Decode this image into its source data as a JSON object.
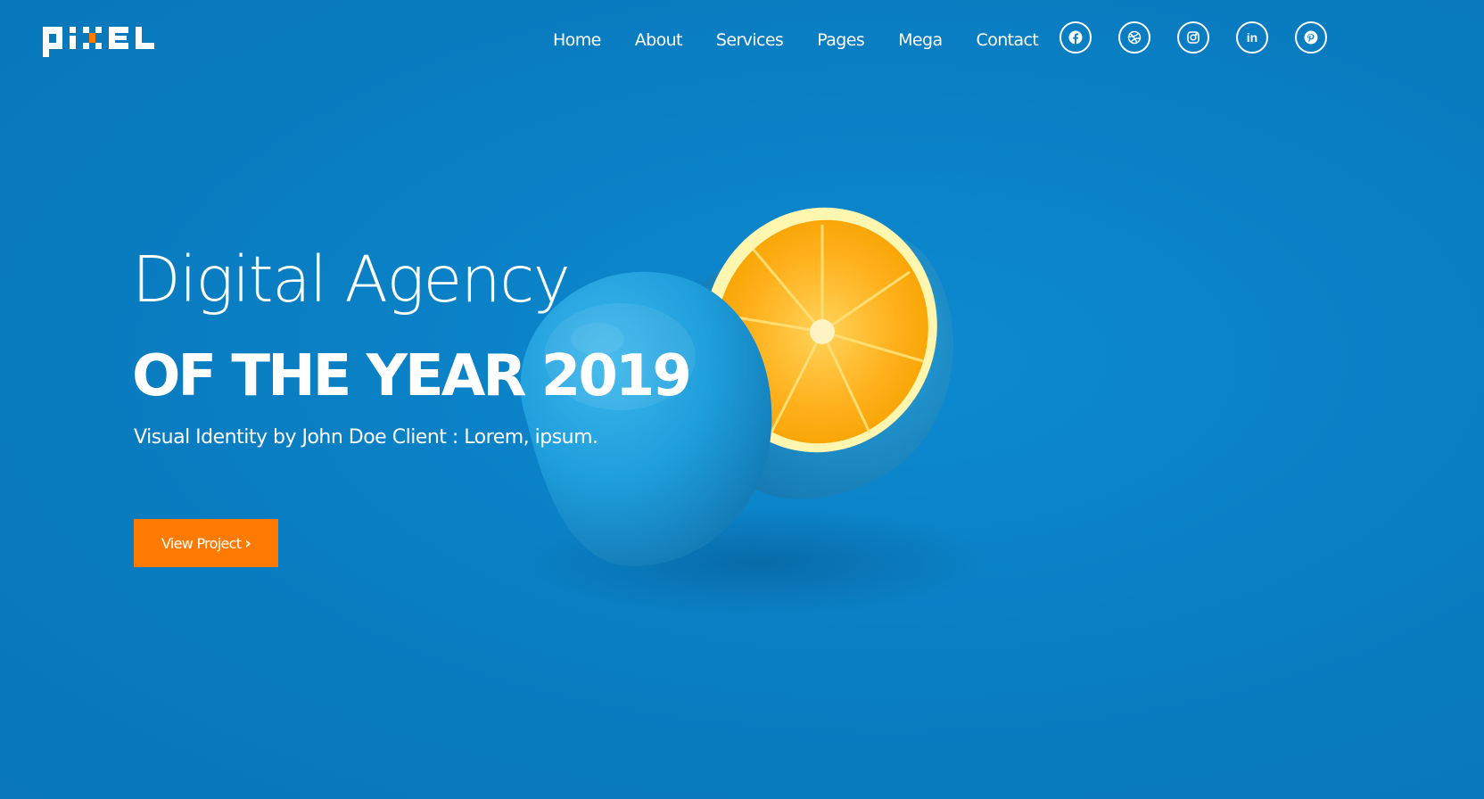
{
  "brand": {
    "name": "pixel",
    "logo_white": "#ffffff",
    "logo_accent": "#ff7a00"
  },
  "nav": {
    "items": [
      {
        "label": "Home"
      },
      {
        "label": "About"
      },
      {
        "label": "Services"
      },
      {
        "label": "Pages"
      },
      {
        "label": "Mega"
      },
      {
        "label": "Contact"
      }
    ]
  },
  "social": [
    {
      "icon": "facebook-icon"
    },
    {
      "icon": "dribbble-icon"
    },
    {
      "icon": "instagram-icon"
    },
    {
      "icon": "linkedin-icon",
      "text": "in"
    },
    {
      "icon": "pinterest-icon"
    }
  ],
  "hero": {
    "title": "Digital Agency",
    "subtitle": "OF THE YEAR 2019",
    "caption": "Visual Identity by John Doe Client : Lorem, ipsum.",
    "cta_label": "View Project",
    "cta_icon": "chevron-right-icon",
    "cta_glyph": "›"
  },
  "colors": {
    "background": "#0a7fc4",
    "accent": "#ff7a00",
    "orange_flesh": "#ffb020",
    "peel_blue": "#1e9edb"
  }
}
